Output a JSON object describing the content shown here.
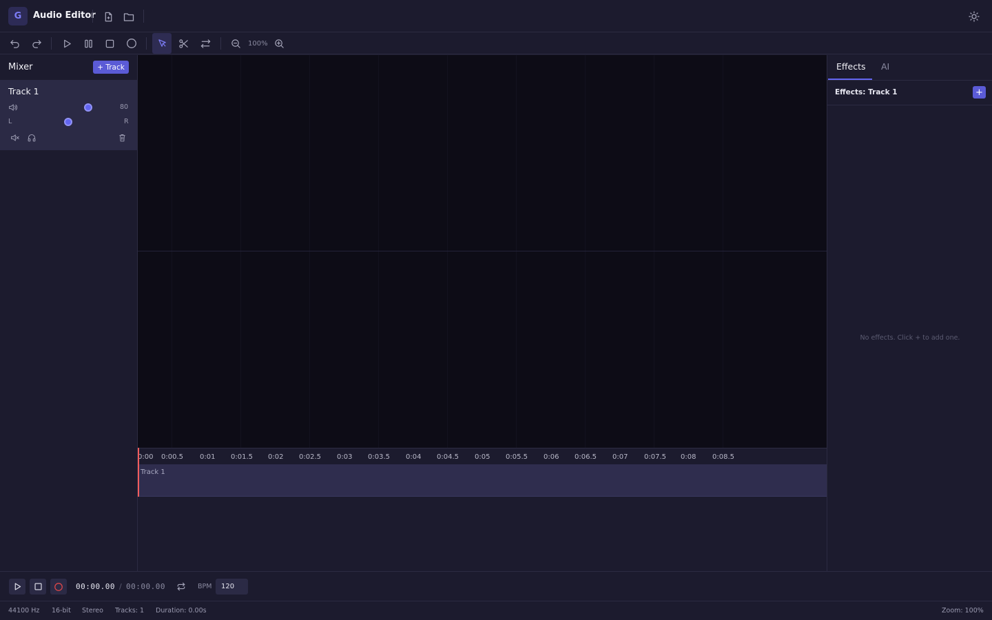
{
  "app": {
    "logo": "G",
    "title": "Audio Editor"
  },
  "toolbar": {
    "zoom": "100%"
  },
  "mixer": {
    "title": "Mixer",
    "add_track_label": "+ Track",
    "track": {
      "name": "Track 1",
      "volume": "80",
      "volume_level": 0.8,
      "pan_left": "L",
      "pan_right": "R",
      "pan_position": "center"
    }
  },
  "timeline": {
    "ticks": [
      "0:00",
      "0:00.5",
      "0:01",
      "0:01.5",
      "0:02",
      "0:02.5",
      "0:03",
      "0:03.5",
      "0:04",
      "0:04.5",
      "0:05",
      "0:05.5",
      "0:06",
      "0:06.5",
      "0:07",
      "0:07.5",
      "0:08",
      "0:08.5"
    ],
    "clip_label": "Track 1"
  },
  "right_panel": {
    "tabs": [
      "Effects",
      "AI"
    ],
    "active_tab": "Effects",
    "effects_title": "Effects: Track 1",
    "add_label": "+",
    "empty_message": "No effects. Click + to add one."
  },
  "transport": {
    "time_current": "00:00.00",
    "time_separator": "/",
    "time_total": "00:00.00",
    "bpm_label": "BPM",
    "bpm_value": "120"
  },
  "status": {
    "sample_rate": "44100 Hz",
    "bit_depth": "16-bit",
    "channels": "Stereo",
    "tracks": "Tracks: 1",
    "duration": "Duration: 0.00s",
    "zoom": "Zoom: 100%"
  },
  "colors": {
    "accent": "#6366f1",
    "accent_button": "#5b5bd6",
    "playhead": "#f25c5c",
    "record": "#e54848",
    "background": "#1c1b2e",
    "canvas": "#0d0c16"
  }
}
